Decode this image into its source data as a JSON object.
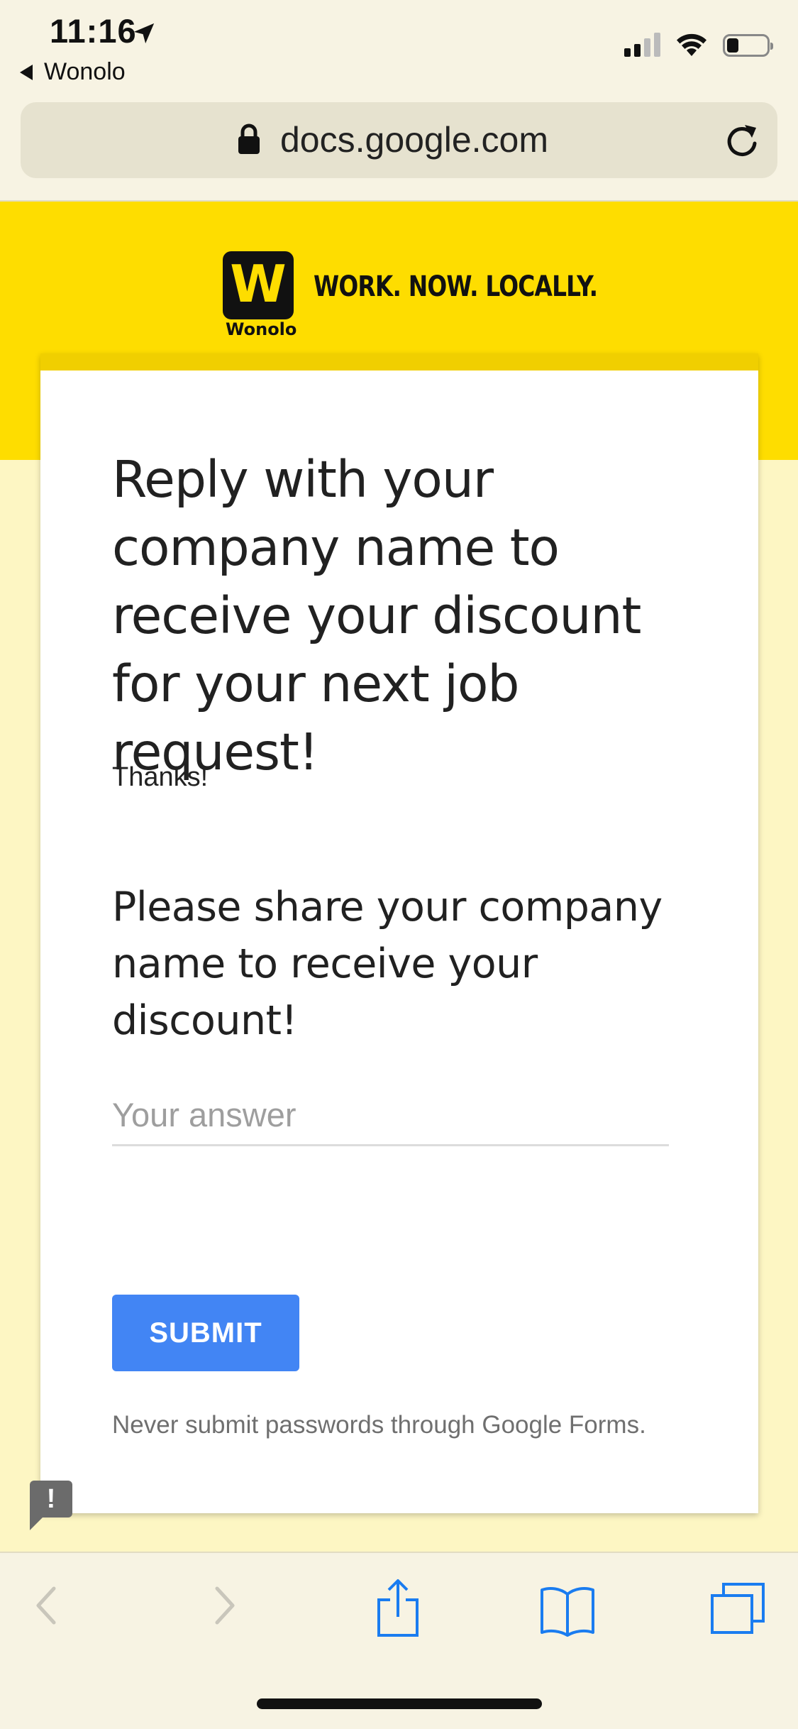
{
  "status_bar": {
    "time": "11:16",
    "back_app": "Wonolo",
    "signal_bars_active": 2,
    "signal_bars_total": 4,
    "battery_level": 0.3
  },
  "browser": {
    "url": "docs.google.com",
    "lock_icon": "lock-icon",
    "reload_icon": "reload-icon"
  },
  "header": {
    "logo_letter": "W",
    "logo_word": "Wonolo",
    "tagline": "WORK. NOW. LOCALLY.",
    "band_color": "#fedd00"
  },
  "form": {
    "title": "Reply with your company name to receive your discount for your next job request!",
    "description": "Thanks!",
    "question": "Please share your company name to receive your discount!",
    "answer_placeholder": "Your answer",
    "answer_value": "",
    "submit_label": "SUBMIT",
    "submit_color": "#4285f4",
    "disclaimer": "Never submit passwords through Google Forms.",
    "report_badge": "!"
  },
  "toolbar": {
    "items": [
      "back-icon",
      "forward-icon",
      "share-icon",
      "bookmarks-icon",
      "tabs-icon"
    ],
    "accent_color": "#1a7cf0"
  }
}
